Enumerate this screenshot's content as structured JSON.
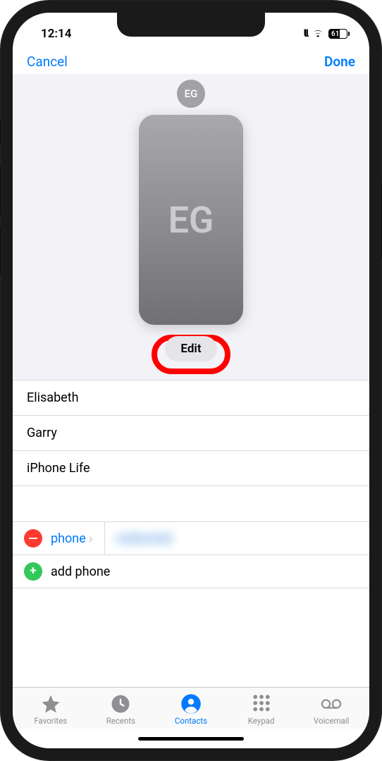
{
  "status": {
    "time": "12:14",
    "battery_percent": "61"
  },
  "nav": {
    "cancel": "Cancel",
    "done": "Done"
  },
  "poster": {
    "small_initials": "EG",
    "large_initials": "EG",
    "edit_label": "Edit"
  },
  "fields": {
    "first_name": "Elisabeth",
    "last_name": "Garry",
    "company": "iPhone Life"
  },
  "phone": {
    "label": "phone",
    "value": "redacted",
    "add_label": "add phone"
  },
  "tabs": {
    "favorites": "Favorites",
    "recents": "Recents",
    "contacts": "Contacts",
    "keypad": "Keypad",
    "voicemail": "Voicemail",
    "active": "contacts"
  }
}
